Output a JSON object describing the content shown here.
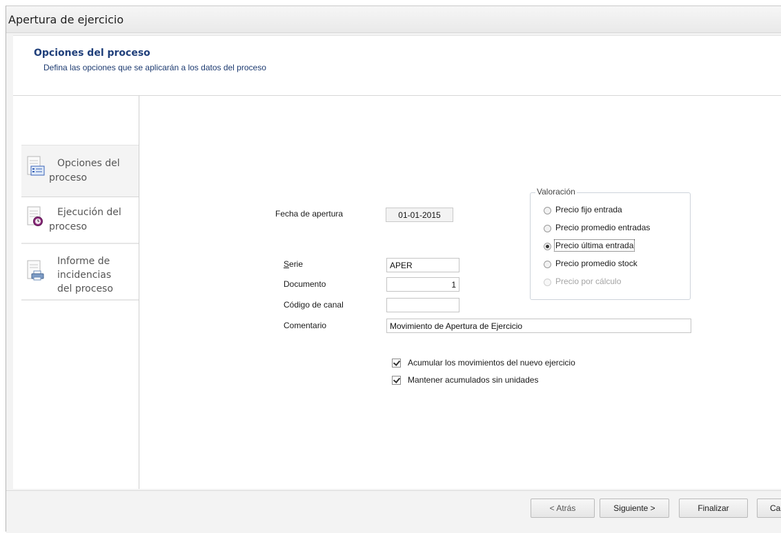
{
  "window": {
    "title": "Apertura de ejercicio"
  },
  "header": {
    "title": "Opciones del proceso",
    "subtitle": "Defina las opciones que se aplicarán a los datos del proceso"
  },
  "sidebar": {
    "items": [
      {
        "line1": "Opciones del",
        "line2": "proceso",
        "icon": "options-list-icon",
        "active": true
      },
      {
        "line1": "Ejecución del",
        "line2": "proceso",
        "icon": "clock-execution-icon",
        "active": false
      },
      {
        "line1": "Informe de",
        "line2": "incidencias",
        "line3": "del proceso",
        "icon": "printer-report-icon",
        "active": false
      }
    ]
  },
  "form": {
    "fecha_label": "Fecha de apertura",
    "fecha_value": "01-01-2015",
    "serie_label": "Serie",
    "serie_value": "APER",
    "documento_label": "Documento",
    "documento_value": "1",
    "canal_label": "Código de canal",
    "canal_value": "",
    "comentario_label": "Comentario",
    "comentario_value": "Movimiento de Apertura de Ejercicio"
  },
  "valoracion": {
    "legend": "Valoración",
    "options": [
      {
        "label": "Precio fijo entrada",
        "selected": false,
        "enabled": true
      },
      {
        "label": "Precio promedio entradas",
        "selected": false,
        "enabled": true
      },
      {
        "label": "Precio última entrada",
        "selected": true,
        "enabled": true
      },
      {
        "label": "Precio promedio stock",
        "selected": false,
        "enabled": true
      },
      {
        "label": "Precio por cálculo",
        "selected": false,
        "enabled": false
      }
    ]
  },
  "checks": [
    {
      "label": "Acumular los movimientos del nuevo ejercicio",
      "checked": true
    },
    {
      "label": "Mantener acumulados sin unidades",
      "checked": true
    }
  ],
  "buttons": {
    "back": "< Atrás",
    "next": "Siguiente >",
    "finish": "Finalizar",
    "cancel": "Ca"
  },
  "colors": {
    "header_title": "#1f3f7a",
    "header_subtitle": "#1c3a70",
    "background": "#f3f3f3"
  }
}
